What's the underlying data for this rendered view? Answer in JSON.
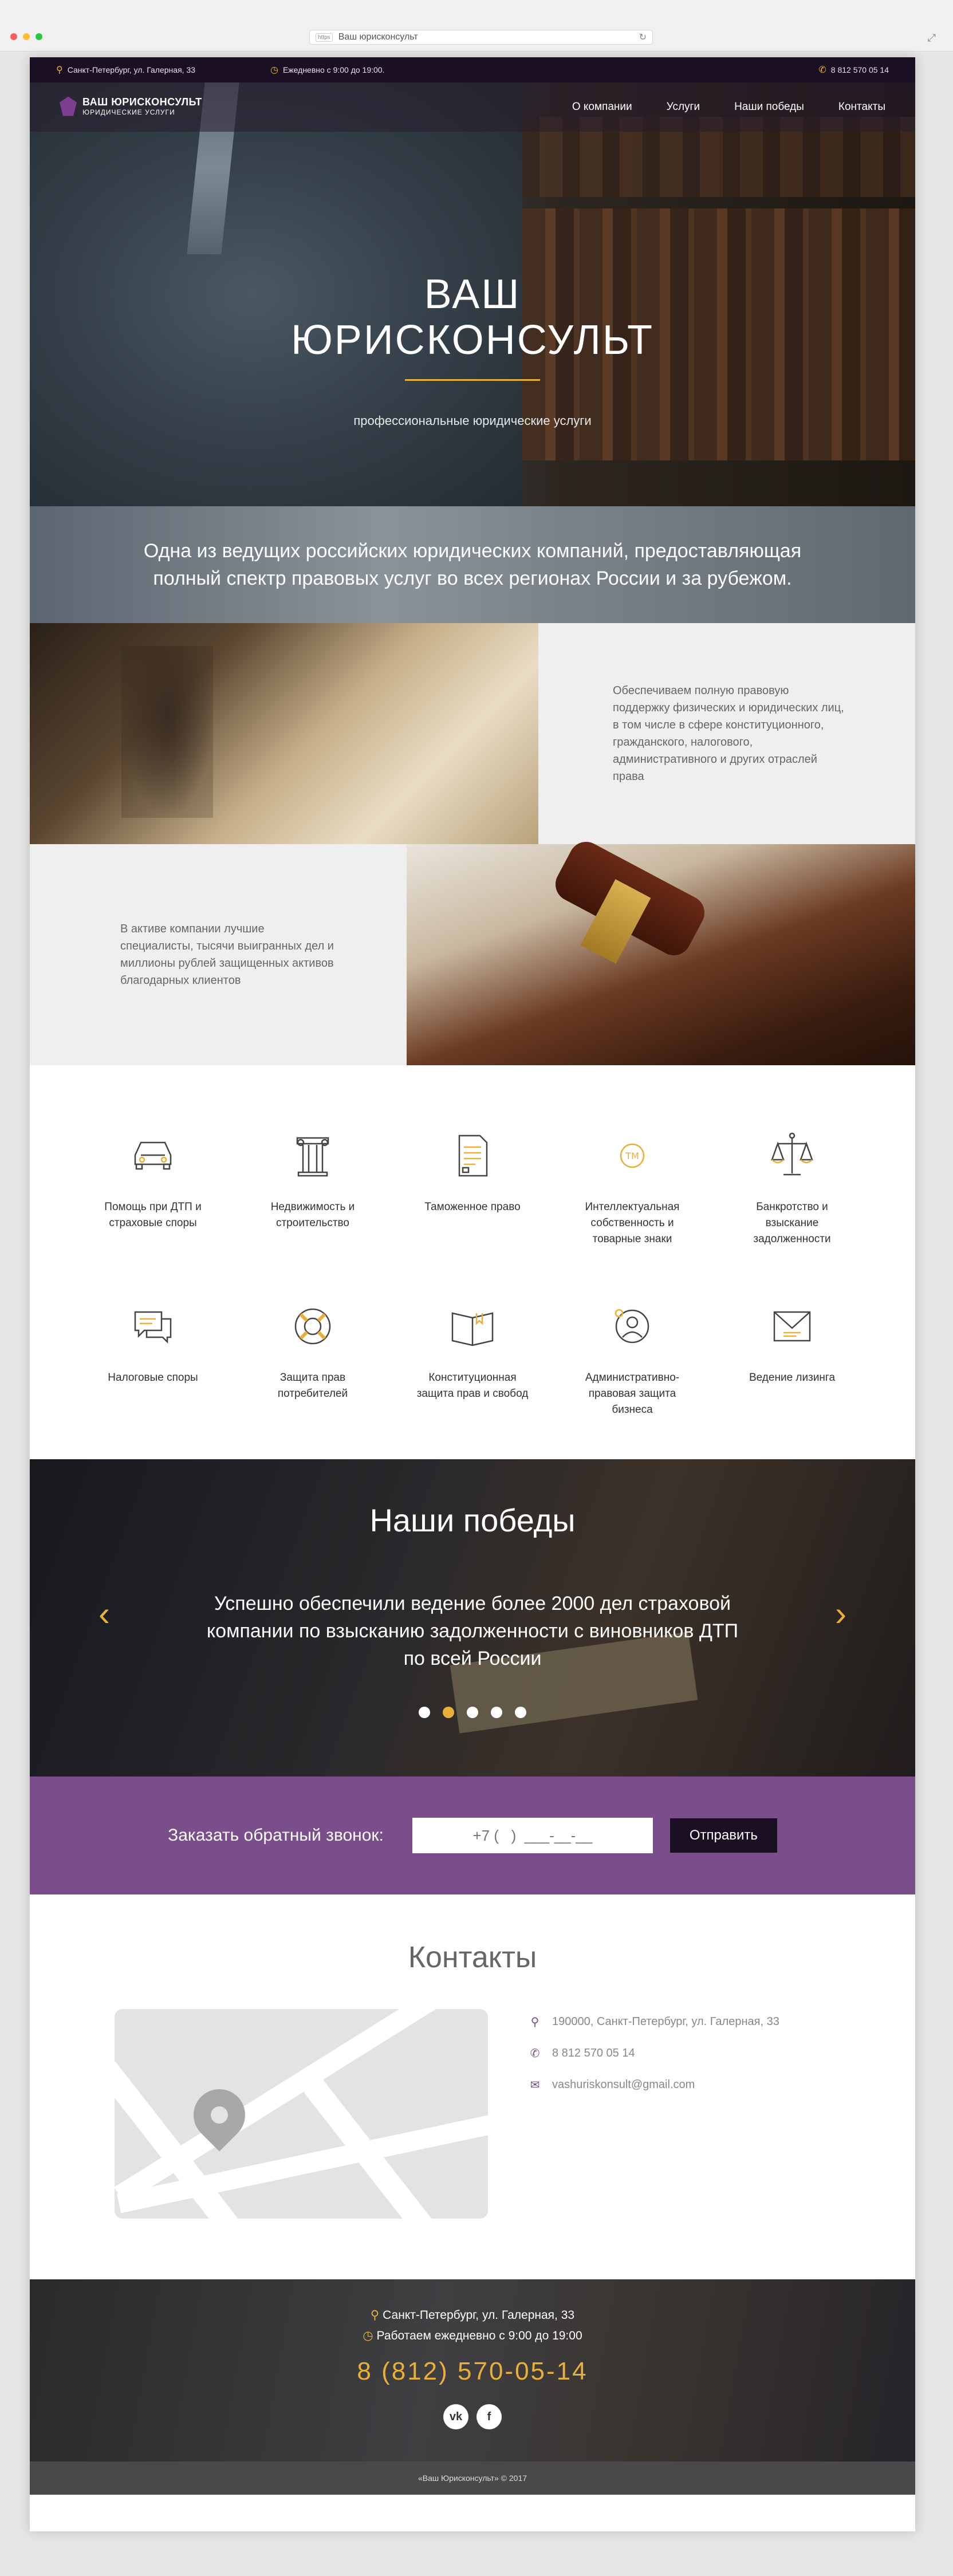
{
  "browser": {
    "protocol_badge": "https",
    "url_text": "Ваш юрисконсульт",
    "colors": {
      "close": "#ff5f57",
      "minimize": "#febc2e",
      "zoom": "#28c840"
    }
  },
  "topbar": {
    "address": "Санкт-Петербург, ул. Галерная, 33",
    "hours": "Ежедневно с 9:00 до 19:00.",
    "phone": "8 812 570 05 14"
  },
  "logo": {
    "title": "ВАШ ЮРИСКОНСУЛЬТ",
    "subtitle": "ЮРИДИЧЕСКИЕ УСЛУГИ"
  },
  "nav": [
    "О компании",
    "Услуги",
    "Наши победы",
    "Контакты"
  ],
  "hero": {
    "title_line1": "ВАШ",
    "title_line2": "ЮРИСКОНСУЛЬТ",
    "subtitle": "профессиональные юридические услуги"
  },
  "strip": {
    "text": "Одна из ведущих российских юридических компаний, предоставляющая полный спектр правовых услуг во всех регионах России и за рубежом."
  },
  "features": [
    {
      "text": "Обеспечиваем полную правовую поддержку физических и юридических лиц, в том числе в сфере конституционного, гражданского, налогового, административного и других отраслей права"
    },
    {
      "text": "В активе компании лучшие специалисты, тысячи выигранных дел и миллионы рублей защищенных активов благодарных клиентов"
    }
  ],
  "services": [
    {
      "label": "Помощь при ДТП и страховые споры",
      "icon": "car-icon"
    },
    {
      "label": "Недвижимость и строительство",
      "icon": "column-icon"
    },
    {
      "label": "Таможенное право",
      "icon": "document-icon"
    },
    {
      "label": "Интеллектуальная собственность и товарные знаки",
      "icon": "trademark-icon"
    },
    {
      "label": "Банкротство и взыскание задолженности",
      "icon": "scales-icon"
    },
    {
      "label": "Налоговые споры",
      "icon": "chat-icon"
    },
    {
      "label": "Защита прав потребителей",
      "icon": "lifebuoy-icon"
    },
    {
      "label": "Конституционная защита прав и свобод",
      "icon": "book-icon"
    },
    {
      "label": "Административно-правовая защита бизнеса",
      "icon": "user-circle-icon"
    },
    {
      "label": "Ведение лизинга",
      "icon": "envelope-icon"
    }
  ],
  "wins": {
    "title": "Наши победы",
    "text": "Успешно обеспечили ведение более 2000 дел страховой компании по взысканию задолженности с виновников ДТП по всей России",
    "prev": "‹",
    "next": "›",
    "slides": 5,
    "active_slide": 2
  },
  "callback": {
    "label": "Заказать обратный звонок:",
    "placeholder": "+7 (   )  ___-__-__",
    "button": "Отправить"
  },
  "contacts": {
    "title": "Контакты",
    "address": "190000, Санкт-Петербург, ул. Галерная, 33",
    "phone": "8 812 570 05 14",
    "email": "vashuriskonsult@gmail.com"
  },
  "footer": {
    "address": "Санкт-Петербург, ул. Галерная, 33",
    "hours": "Работаем ежедневно с 9:00 до 19:00",
    "phone": "8 (812) 570-05-14",
    "social_vk": "vk",
    "social_fb": "f",
    "copyright": "«Ваш Юрисконсульт» © 2017"
  },
  "colors": {
    "accent_gold": "#e8b03a",
    "brand_purple": "#7a4e8a",
    "dark": "#1b0f24"
  }
}
